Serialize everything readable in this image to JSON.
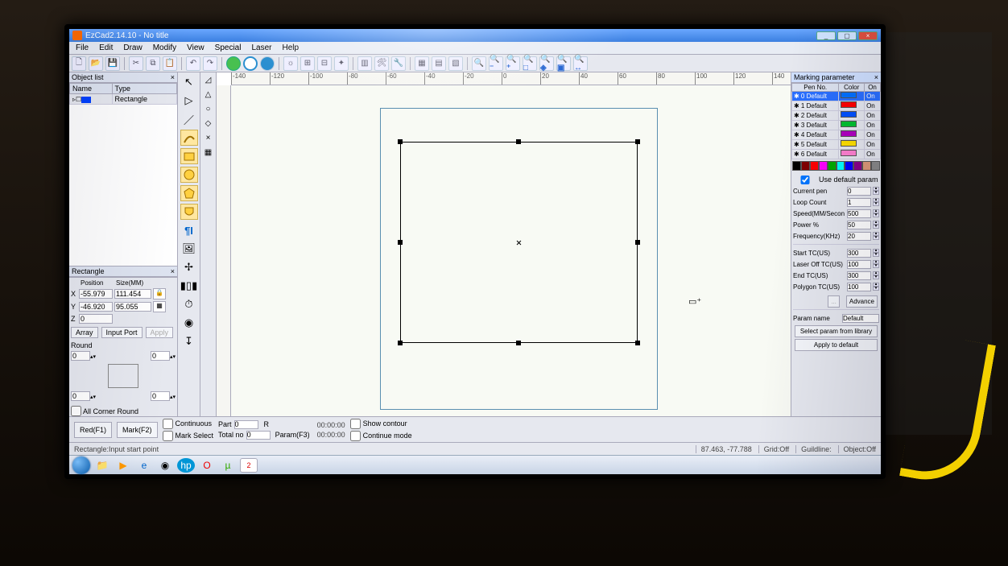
{
  "title": "EzCad2.14.10 - No title",
  "menu": [
    "File",
    "Edit",
    "Draw",
    "Modify",
    "View",
    "Special",
    "Laser",
    "Help"
  ],
  "objectlist": {
    "title": "Object list",
    "cols": [
      "Name",
      "Type"
    ],
    "rows": [
      {
        "name": "",
        "type": "Rectangle"
      }
    ]
  },
  "proppanel": {
    "title": "Rectangle",
    "position_label": "Position",
    "size_label": "Size(MM)",
    "x": "-55.979",
    "w": "111.454",
    "y": "-46.920",
    "h": "95.055",
    "z": "0",
    "array_btn": "Array",
    "inport_btn": "Input Port",
    "apply_btn": "Apply",
    "round_label": "Round",
    "r1": "0",
    "r2": "0",
    "r3": "0",
    "r4": "0",
    "allcorner": "All Corner Round"
  },
  "ruler_x": [
    "-140",
    "-120",
    "-100",
    "-80",
    "-60",
    "-40",
    "-20",
    "0",
    "20",
    "40",
    "60",
    "80",
    "100",
    "120",
    "140"
  ],
  "bottom": {
    "red_btn": "Red(F1)",
    "mark_btn": "Mark(F2)",
    "continuous": "Continuous",
    "part": "Part",
    "part_v": "0",
    "r": "R",
    "markselect": "Mark Select",
    "total": "Total no",
    "total_v": "0",
    "param": "Param(F3)",
    "t1": "00:00:00",
    "t2": "00:00:00",
    "showcontour": "Show contour",
    "continuemode": "Continue mode"
  },
  "status": {
    "msg": "Rectangle:Input start point",
    "coord": "87.463, -77.788",
    "grid": "Grid:Off",
    "guild": "Guildline:",
    "obj": "Object:Off"
  },
  "marking": {
    "title": "Marking parameter",
    "cols": [
      "Pen No.",
      "Color",
      "On"
    ],
    "pens": [
      {
        "n": "0 Default",
        "c": "#0070ff",
        "on": "On",
        "sel": true
      },
      {
        "n": "1 Default",
        "c": "#ff0000",
        "on": "On"
      },
      {
        "n": "2 Default",
        "c": "#0050ff",
        "on": "On"
      },
      {
        "n": "3 Default",
        "c": "#00c030",
        "on": "On"
      },
      {
        "n": "4 Default",
        "c": "#b000c0",
        "on": "On"
      },
      {
        "n": "5 Default",
        "c": "#ffe000",
        "on": "On"
      },
      {
        "n": "6 Default",
        "c": "#ff80d0",
        "on": "On"
      }
    ],
    "palette": [
      "#000",
      "#800000",
      "#f00",
      "#f0f",
      "#0a0",
      "#0ff",
      "#00f",
      "#808",
      "#d97",
      "#888"
    ],
    "usedefault": "Use default param",
    "params": [
      {
        "k": "Current pen",
        "v": "0"
      },
      {
        "k": "Loop Count",
        "v": "1"
      },
      {
        "k": "Speed(MM/Secon",
        "v": "500"
      },
      {
        "k": "Power %",
        "v": "50"
      },
      {
        "k": "Frequency(KHz)",
        "v": "20"
      }
    ],
    "params2": [
      {
        "k": "Start TC(US)",
        "v": "300"
      },
      {
        "k": "Laser Off TC(US)",
        "v": "100"
      },
      {
        "k": "End TC(US)",
        "v": "300"
      },
      {
        "k": "Polygon TC(US)",
        "v": "100"
      }
    ],
    "btn1": "...",
    "btn2": "Advance",
    "paramname_lbl": "Param name",
    "paramname": "Default",
    "selectlib": "Select param from library",
    "applydef": "Apply to default"
  },
  "tray": {
    "time": "",
    "date": ""
  }
}
